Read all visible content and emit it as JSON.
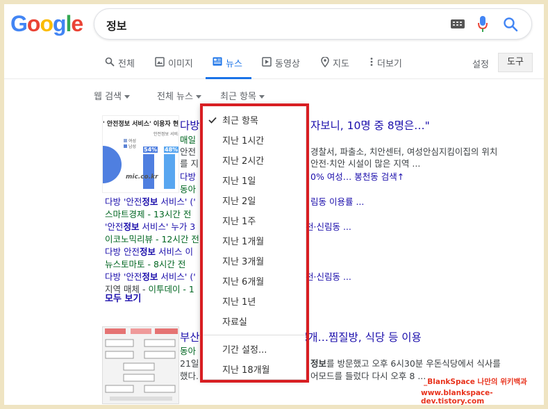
{
  "logo": {
    "text": [
      "G",
      "o",
      "o",
      "g",
      "l",
      "e"
    ],
    "colors": [
      "#4285f4",
      "#ea4335",
      "#fbbc05",
      "#4285f4",
      "#34a853",
      "#ea4335"
    ]
  },
  "search": {
    "query": "정보"
  },
  "tabs": [
    {
      "label": "전체",
      "icon": "search-icon"
    },
    {
      "label": "이미지",
      "icon": "image-icon"
    },
    {
      "label": "뉴스",
      "icon": "news-icon",
      "active": true
    },
    {
      "label": "동영상",
      "icon": "play-icon"
    },
    {
      "label": "지도",
      "icon": "pin-icon"
    },
    {
      "label": "더보기",
      "icon": "more-vert-icon"
    }
  ],
  "settings_label": "설정",
  "tools_label": "도구",
  "filters": {
    "web": "웹 검색",
    "news": "전체 뉴스",
    "recent": "최근 항목"
  },
  "result1": {
    "thumb_title": "' 안전정보 서비스' 이용자 현",
    "thumb_legend_a": "여성",
    "thumb_legend_b": "남성",
    "thumb_legend_c": "안전정보 서비스",
    "thumb_pct1": "54%",
    "thumb_pct2": "48%",
    "thumb_watermark": "mic.co.kr",
    "title_start": "다방",
    "title_end": "자보니, 10명 중 8명은…\"",
    "source": "매일",
    "snip1_start": "안전",
    "snip1_end": "경찰서, 파출소, 치안센터, 여성안심지킴이집의 위치",
    "snip2_start": "를 지",
    "snip2_end": "안전·치안 시설이 많은 지역 ...",
    "link_start": "다방",
    "link_end": "0% 여성… 봉천동 검색↑",
    "link_src": "동아"
  },
  "related": [
    {
      "title_a": "다방 '안전",
      "kw": "정보",
      "title_b": " 서비스' ('",
      "tail": "림동 이용률 ...",
      "src": "스마트경제 - 13시간 전"
    },
    {
      "title_a": "'안전",
      "kw": "정보",
      "title_b": " 서비스' 누가 3",
      "tail": "천·신림동 ...",
      "src": "이코노믹리뷰 - 12시간 전"
    },
    {
      "title_a": "다방 안전",
      "kw": "정보",
      "title_b": " 서비스 이",
      "tail": "",
      "src": "뉴스토마토 - 8시간 전"
    },
    {
      "title_a": "다방 '안전",
      "kw": "정보",
      "title_b": " 서비스' ('",
      "tail": "천·신림동 ...",
      "src_a": "지역 매체 - ",
      "src_b": "이투데이 - 1"
    }
  ],
  "more_label": "모두 보기",
  "result2": {
    "title_start": "부산",
    "title_end": "공개…찜질방, 식당 등 이용",
    "source": "동아",
    "snip1_start": "21일",
    "snip1_kw": "정보",
    "snip1_end": "를 방문했고 오후 6시30분 우돈식당에서 식사를",
    "snip2_start": "했다.",
    "snip2_end": "어모드를 들렀다 다시 오후 8 ..."
  },
  "dropdown": {
    "items": [
      "최근 항목",
      "지난 1시간",
      "지난 2시간",
      "지난 1일",
      "지난 2일",
      "지난 1주",
      "지난 1개월",
      "지난 3개월",
      "지난 6개월",
      "지난 1년",
      "자료실"
    ],
    "custom_range": "기간 설정...",
    "extra": "지난 18개월",
    "selected_index": 0
  },
  "watermark": {
    "line1": "_BlankSpace 나만의 위키백과",
    "line2": "www.blankspace-dev.tistory.com"
  },
  "colors": {
    "accent": "#1a73e8",
    "highlight_border": "#d81e22",
    "link": "#1a0dab",
    "source_green": "#006621"
  }
}
